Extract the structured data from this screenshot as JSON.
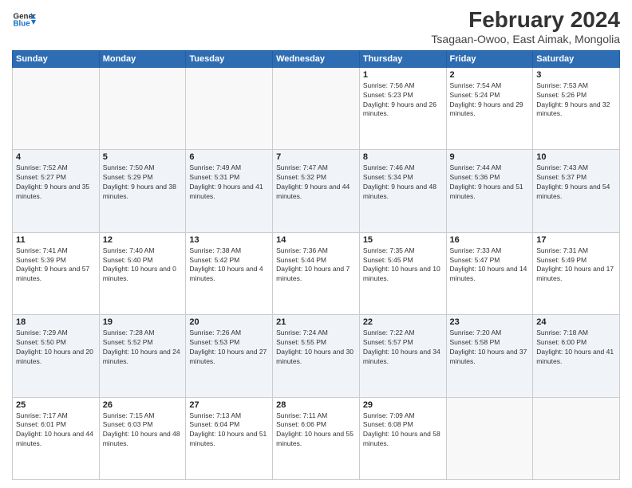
{
  "header": {
    "logo_line1": "General",
    "logo_line2": "Blue",
    "month_year": "February 2024",
    "location": "Tsagaan-Owoo, East Aimak, Mongolia"
  },
  "weekdays": [
    "Sunday",
    "Monday",
    "Tuesday",
    "Wednesday",
    "Thursday",
    "Friday",
    "Saturday"
  ],
  "weeks": [
    [
      {
        "day": "",
        "info": ""
      },
      {
        "day": "",
        "info": ""
      },
      {
        "day": "",
        "info": ""
      },
      {
        "day": "",
        "info": ""
      },
      {
        "day": "1",
        "info": "Sunrise: 7:56 AM\nSunset: 5:23 PM\nDaylight: 9 hours and 26 minutes."
      },
      {
        "day": "2",
        "info": "Sunrise: 7:54 AM\nSunset: 5:24 PM\nDaylight: 9 hours and 29 minutes."
      },
      {
        "day": "3",
        "info": "Sunrise: 7:53 AM\nSunset: 5:26 PM\nDaylight: 9 hours and 32 minutes."
      }
    ],
    [
      {
        "day": "4",
        "info": "Sunrise: 7:52 AM\nSunset: 5:27 PM\nDaylight: 9 hours and 35 minutes."
      },
      {
        "day": "5",
        "info": "Sunrise: 7:50 AM\nSunset: 5:29 PM\nDaylight: 9 hours and 38 minutes."
      },
      {
        "day": "6",
        "info": "Sunrise: 7:49 AM\nSunset: 5:31 PM\nDaylight: 9 hours and 41 minutes."
      },
      {
        "day": "7",
        "info": "Sunrise: 7:47 AM\nSunset: 5:32 PM\nDaylight: 9 hours and 44 minutes."
      },
      {
        "day": "8",
        "info": "Sunrise: 7:46 AM\nSunset: 5:34 PM\nDaylight: 9 hours and 48 minutes."
      },
      {
        "day": "9",
        "info": "Sunrise: 7:44 AM\nSunset: 5:36 PM\nDaylight: 9 hours and 51 minutes."
      },
      {
        "day": "10",
        "info": "Sunrise: 7:43 AM\nSunset: 5:37 PM\nDaylight: 9 hours and 54 minutes."
      }
    ],
    [
      {
        "day": "11",
        "info": "Sunrise: 7:41 AM\nSunset: 5:39 PM\nDaylight: 9 hours and 57 minutes."
      },
      {
        "day": "12",
        "info": "Sunrise: 7:40 AM\nSunset: 5:40 PM\nDaylight: 10 hours and 0 minutes."
      },
      {
        "day": "13",
        "info": "Sunrise: 7:38 AM\nSunset: 5:42 PM\nDaylight: 10 hours and 4 minutes."
      },
      {
        "day": "14",
        "info": "Sunrise: 7:36 AM\nSunset: 5:44 PM\nDaylight: 10 hours and 7 minutes."
      },
      {
        "day": "15",
        "info": "Sunrise: 7:35 AM\nSunset: 5:45 PM\nDaylight: 10 hours and 10 minutes."
      },
      {
        "day": "16",
        "info": "Sunrise: 7:33 AM\nSunset: 5:47 PM\nDaylight: 10 hours and 14 minutes."
      },
      {
        "day": "17",
        "info": "Sunrise: 7:31 AM\nSunset: 5:49 PM\nDaylight: 10 hours and 17 minutes."
      }
    ],
    [
      {
        "day": "18",
        "info": "Sunrise: 7:29 AM\nSunset: 5:50 PM\nDaylight: 10 hours and 20 minutes."
      },
      {
        "day": "19",
        "info": "Sunrise: 7:28 AM\nSunset: 5:52 PM\nDaylight: 10 hours and 24 minutes."
      },
      {
        "day": "20",
        "info": "Sunrise: 7:26 AM\nSunset: 5:53 PM\nDaylight: 10 hours and 27 minutes."
      },
      {
        "day": "21",
        "info": "Sunrise: 7:24 AM\nSunset: 5:55 PM\nDaylight: 10 hours and 30 minutes."
      },
      {
        "day": "22",
        "info": "Sunrise: 7:22 AM\nSunset: 5:57 PM\nDaylight: 10 hours and 34 minutes."
      },
      {
        "day": "23",
        "info": "Sunrise: 7:20 AM\nSunset: 5:58 PM\nDaylight: 10 hours and 37 minutes."
      },
      {
        "day": "24",
        "info": "Sunrise: 7:18 AM\nSunset: 6:00 PM\nDaylight: 10 hours and 41 minutes."
      }
    ],
    [
      {
        "day": "25",
        "info": "Sunrise: 7:17 AM\nSunset: 6:01 PM\nDaylight: 10 hours and 44 minutes."
      },
      {
        "day": "26",
        "info": "Sunrise: 7:15 AM\nSunset: 6:03 PM\nDaylight: 10 hours and 48 minutes."
      },
      {
        "day": "27",
        "info": "Sunrise: 7:13 AM\nSunset: 6:04 PM\nDaylight: 10 hours and 51 minutes."
      },
      {
        "day": "28",
        "info": "Sunrise: 7:11 AM\nSunset: 6:06 PM\nDaylight: 10 hours and 55 minutes."
      },
      {
        "day": "29",
        "info": "Sunrise: 7:09 AM\nSunset: 6:08 PM\nDaylight: 10 hours and 58 minutes."
      },
      {
        "day": "",
        "info": ""
      },
      {
        "day": "",
        "info": ""
      }
    ]
  ]
}
